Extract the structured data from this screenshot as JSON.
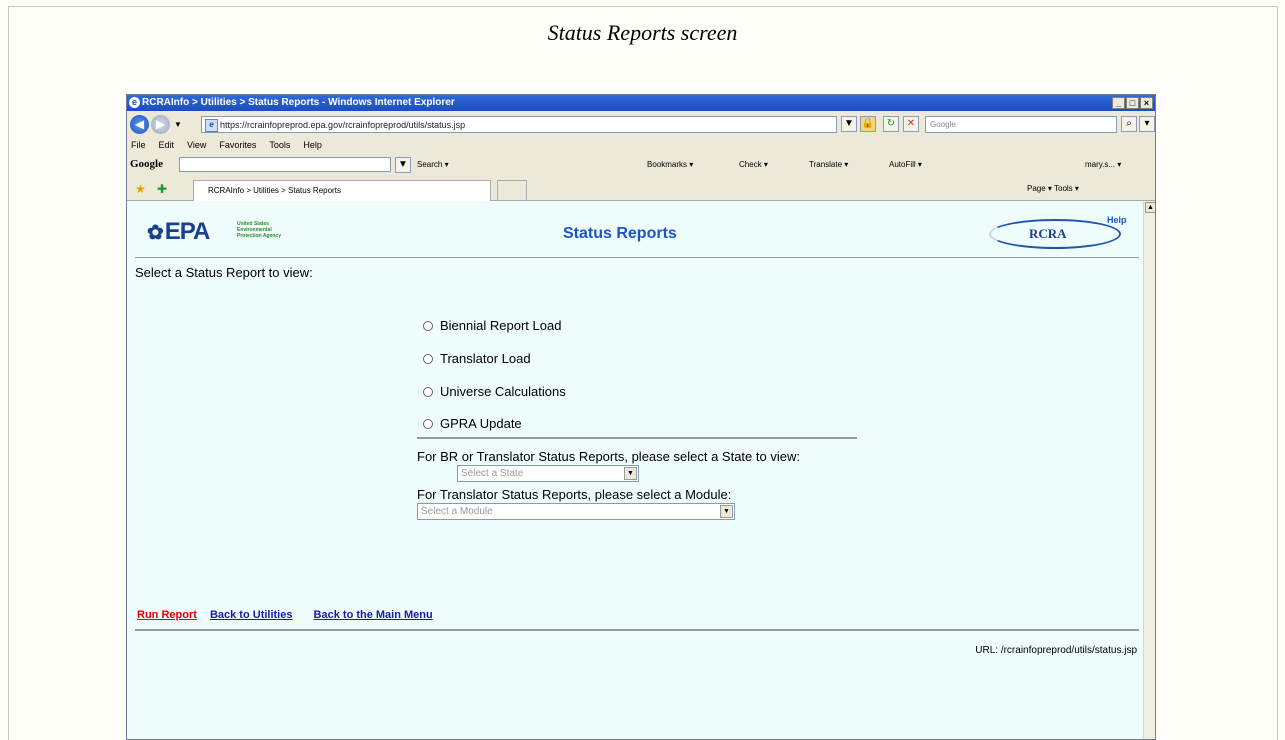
{
  "caption": "Status Reports screen",
  "window": {
    "title": "RCRAInfo > Utilities > Status Reports - Windows Internet Explorer",
    "controls": [
      "_",
      "□",
      "×"
    ]
  },
  "address": {
    "url": "https://rcrainfopreprod.epa.gov/rcrainfopreprod/utils/status.jsp",
    "search_placeholder": "Google"
  },
  "menu": [
    "File",
    "Edit",
    "View",
    "Favorites",
    "Tools",
    "Help"
  ],
  "google_toolbar": {
    "logo": "Google",
    "items": [
      "Search ▾",
      "Bookmarks ▾",
      "Check ▾",
      "Translate ▾",
      "AutoFill ▾",
      "mary.s... ▾"
    ]
  },
  "tab": {
    "label": "RCRAInfo > Utilities > Status Reports",
    "command_bar": "Page ▾   Tools ▾"
  },
  "page": {
    "epa_logo": "EPA",
    "epa_subtitle": "United States Environmental Protection Agency",
    "title": "Status Reports",
    "rcra_logo": "RCRA",
    "help": "Help",
    "prompt": "Select a Status Report to view:",
    "options": [
      "Biennial Report Load",
      "Translator Load",
      "Universe Calculations",
      "GPRA Update"
    ],
    "state_prompt": "For BR or Translator Status Reports, please select a State to view:",
    "state_select": "Select a State",
    "module_prompt": "For Translator Status Reports, please select a Module:",
    "module_select": "Select a Module",
    "links": {
      "run": "Run Report",
      "utilities": "Back to Utilities",
      "main_menu": "Back to the Main Menu"
    },
    "url_footer": "URL: /rcrainfopreprod/utils/status.jsp"
  }
}
